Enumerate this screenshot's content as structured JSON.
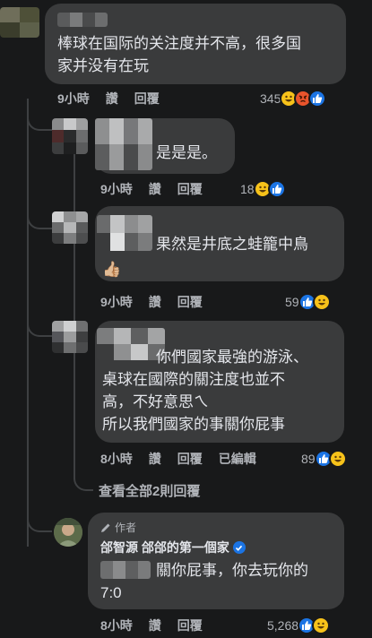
{
  "comments": [
    {
      "text": "棒球在国际的关注度并不高，很多国\n家并没有在玩",
      "time": "9小時",
      "like_label": "讚",
      "reply_label": "回覆",
      "reaction_count": "345"
    },
    {
      "text": "是是是。",
      "time": "9小時",
      "like_label": "讚",
      "reply_label": "回覆",
      "reaction_count": "18"
    },
    {
      "text": "果然是井底之蛙籠中鳥",
      "emoji": "👍🏼",
      "time": "9小時",
      "like_label": "讚",
      "reply_label": "回覆",
      "reaction_count": "59"
    },
    {
      "text": "你們國家最強的游泳、\n桌球在國際的關注度也並不\n高，不好意思ㄟ\n所以我們國家的事關你屁事",
      "time": "8小時",
      "like_label": "讚",
      "reply_label": "回覆",
      "edited_label": "已編輯",
      "reaction_count": "89"
    },
    {
      "author_tag": "作者",
      "author_name": "郃智源 郃郃的第一個家",
      "text": "關你屁事，你去玩你的\n7:0",
      "time": "8小時",
      "like_label": "讚",
      "reply_label": "回覆",
      "reaction_count": "5,268"
    }
  ],
  "view_more_replies": "查看全部2則回覆",
  "icons": {
    "like": "like-icon",
    "haha": "haha-icon",
    "angry": "angry-icon",
    "verified": "verified-badge-icon",
    "pencil": "pencil-icon"
  },
  "colors": {
    "background": "#18191a",
    "bubble": "#3a3b3c",
    "text": "#e4e6eb",
    "meta": "#b0b3b8",
    "like": "#1b74e4",
    "haha": "#f7c21a",
    "angry": "#e9542c"
  }
}
